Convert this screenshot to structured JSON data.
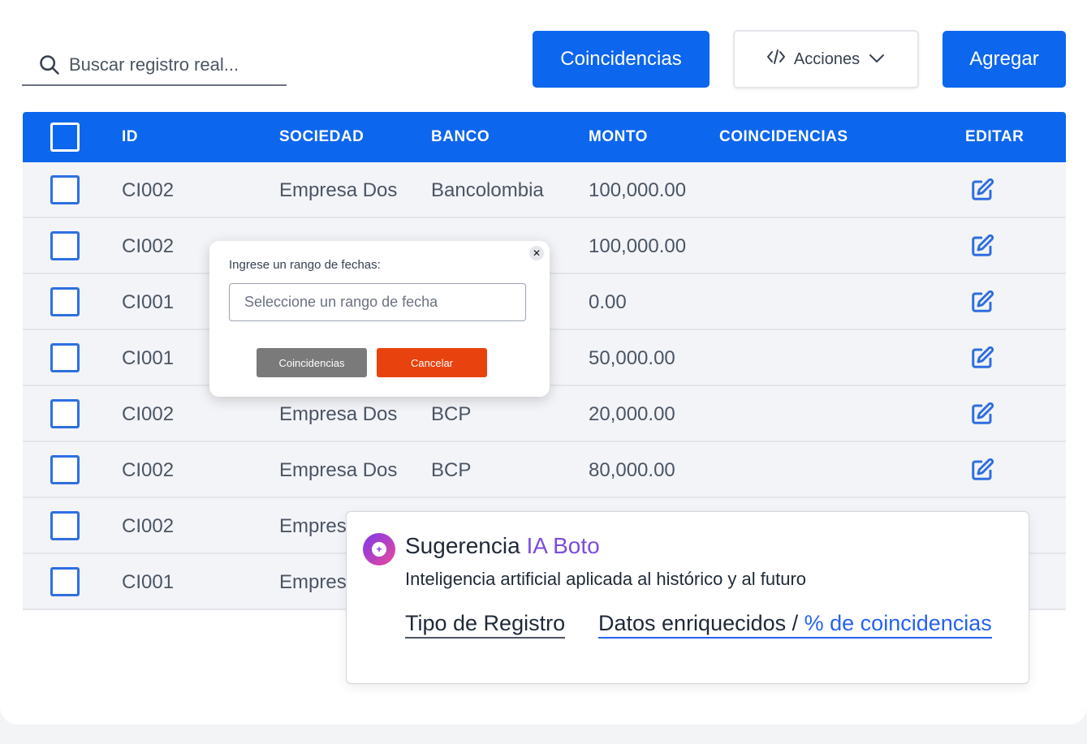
{
  "search": {
    "placeholder": "Buscar registro real..."
  },
  "toolbar": {
    "coincidencias_label": "Coincidencias",
    "acciones_label": "Acciones",
    "agregar_label": "Agregar"
  },
  "table": {
    "headers": {
      "id": "ID",
      "sociedad": "SOCIEDAD",
      "banco": "BANCO",
      "monto": "MONTO",
      "coincidencias": "COINCIDENCIAS",
      "editar": "EDITAR"
    },
    "rows": [
      {
        "id": "CI002",
        "sociedad": "Empresa Dos",
        "banco": "Bancolombia",
        "monto": "100,000.00"
      },
      {
        "id": "CI002",
        "sociedad": "",
        "banco": "",
        "monto": "100,000.00"
      },
      {
        "id": "CI001",
        "sociedad": "",
        "banco": "",
        "monto": "0.00"
      },
      {
        "id": "CI001",
        "sociedad": "",
        "banco": "",
        "monto": "50,000.00"
      },
      {
        "id": "CI002",
        "sociedad": "Empresa Dos",
        "banco": "BCP",
        "monto": "20,000.00"
      },
      {
        "id": "CI002",
        "sociedad": "Empresa Dos",
        "banco": "BCP",
        "monto": "80,000.00"
      },
      {
        "id": "CI002",
        "sociedad": "Empres",
        "banco": "",
        "monto": ""
      },
      {
        "id": "CI001",
        "sociedad": "Empres",
        "banco": "",
        "monto": ""
      }
    ]
  },
  "date_modal": {
    "title": "Ingrese un rango de fechas:",
    "input_placeholder": "Seleccione un rango de fecha",
    "close_label": "✕",
    "coincidencias_label": "Coincidencias",
    "cancelar_label": "Cancelar"
  },
  "ai_suggestion": {
    "title": "Sugerencia",
    "brand": "IA Boto",
    "subtitle": "Inteligencia artificial aplicada al histórico y al futuro",
    "tipo_registro": "Tipo de Registro",
    "datos_enriquecidos": "Datos enriquecidos / ",
    "porcentaje": "% de coincidencias"
  },
  "colors": {
    "primary_blue": "#0d66ee",
    "cancel_red": "#e8420f",
    "neutral_gray": "#7a7a7a",
    "ai_purple": "#7c4ddb"
  }
}
